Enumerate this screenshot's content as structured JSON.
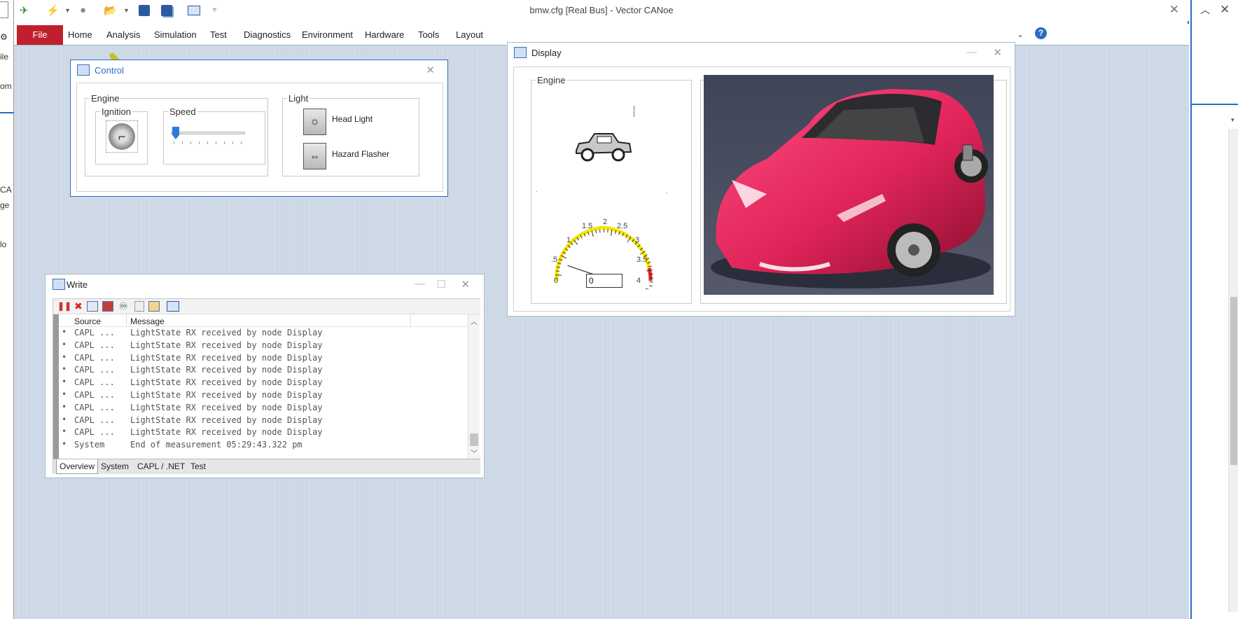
{
  "app": {
    "title": "bmw.cfg [Real Bus] - Vector CANoe",
    "close_glyph": "✕"
  },
  "left_strip": {
    "labels": [
      "ile",
      "om",
      "CA",
      "ge",
      "lo"
    ]
  },
  "menu": {
    "file": "File",
    "items": [
      "Home",
      "Analysis",
      "Simulation",
      "Test",
      "Diagnostics",
      "Environment",
      "Hardware",
      "Tools",
      "Layout"
    ]
  },
  "control_window": {
    "title": "Control",
    "engine_group": "Engine",
    "ignition_label": "Ignition",
    "speed_label": "Speed",
    "speed_value_fraction": 0.02,
    "light_group": "Light",
    "head_light_label": "Head Light",
    "hazard_flasher_label": "Hazard Flasher"
  },
  "display_window": {
    "title": "Display",
    "engine_group": "Engine",
    "gauge": {
      "ticks": [
        "0",
        ".5",
        "1",
        "1.5",
        "2",
        "2.5",
        "3",
        "3.5",
        "4"
      ],
      "value_field": "0",
      "value": 0,
      "min": 0,
      "max": 4
    }
  },
  "write_window": {
    "title": "Write",
    "columns": [
      "Source",
      "Message"
    ],
    "rows": [
      {
        "source": "CAPL ...",
        "message": "LightState RX received by node Display"
      },
      {
        "source": "CAPL ...",
        "message": "LightState RX received by node Display"
      },
      {
        "source": "CAPL ...",
        "message": "LightState RX received by node Display"
      },
      {
        "source": "CAPL ...",
        "message": "LightState RX received by node Display"
      },
      {
        "source": "CAPL ...",
        "message": "LightState RX received by node Display"
      },
      {
        "source": "CAPL ...",
        "message": "LightState RX received by node Display"
      },
      {
        "source": "CAPL ...",
        "message": "LightState RX received by node Display"
      },
      {
        "source": "CAPL ...",
        "message": "LightState RX received by node Display"
      },
      {
        "source": "CAPL ...",
        "message": "LightState RX received by node Display"
      },
      {
        "source": "System",
        "message": "End of measurement 05:29:43.322 pm"
      }
    ],
    "tabs": [
      "Overview",
      "System",
      "CAPL / .NET",
      "Test"
    ]
  },
  "colors": {
    "file_tab": "#c0202e",
    "desktop": "#cdd8e6",
    "car_body": "#e0245a",
    "gauge_yellow": "#f5e400",
    "gauge_red": "#e02020"
  }
}
